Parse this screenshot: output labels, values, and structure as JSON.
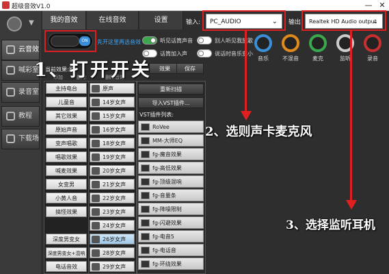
{
  "window": {
    "title": "超级音效V1.0",
    "min": "—",
    "close": "✕"
  },
  "tabs": [
    {
      "label": "我的音效"
    },
    {
      "label": "在线音效"
    },
    {
      "label": "设置"
    }
  ],
  "devices": {
    "input_label": "输入:",
    "input_value": "PC_AUDIO",
    "output_label": "输出:",
    "output_value": "Realtek HD Audio output"
  },
  "sidebar": [
    {
      "label": "云音效"
    },
    {
      "label": "喊彩室"
    },
    {
      "label": "录音室"
    },
    {
      "label": "教程"
    },
    {
      "label": "下载场"
    }
  ],
  "master_toggle": {
    "on_label": "ON",
    "caption": "先开这里再选音效"
  },
  "switches": [
    {
      "label": "听见话筒声音",
      "on": true
    },
    {
      "label": "别人听见我放歌",
      "on": false
    },
    {
      "label": "说话时音乐变小",
      "on": false
    },
    {
      "label": "话筒加入声",
      "on": false
    }
  ],
  "knobs": [
    {
      "label": "音乐",
      "color": "#3a8fd8"
    },
    {
      "label": "不混音",
      "color": "#e08a1e"
    },
    {
      "label": "麦克",
      "color": "#3aa84c"
    },
    {
      "label": "监听",
      "color": "#cccccc"
    },
    {
      "label": "录音",
      "color": "#c83030"
    }
  ],
  "effects_header": "当前效果:原",
  "mini_buttons": [
    "添加",
    "删除",
    "删除音效"
  ],
  "mid_top_buttons": [
    "效果",
    "保存"
  ],
  "mid_buttons": [
    "重新扫描",
    "导入VST插件..."
  ],
  "vst_header": "VST插件列表:",
  "presets": [
    "主持电台",
    "儿童音",
    "其它效果",
    "原始声音",
    "变声唱歌",
    "唱歌效果",
    "喊麦效果",
    "女变男",
    "小黄人音",
    "搞怪效果",
    "深度男变女",
    "深度男变女+混响",
    "电话音效"
  ],
  "samples": [
    "原声",
    "14岁女声",
    "15岁女声",
    "16岁女声",
    "18岁女声",
    "19岁女声",
    "20岁女声",
    "21岁女声",
    "22岁女声",
    "23岁女声",
    "24岁女声",
    "25岁女声",
    "26岁女声",
    "28岁女声",
    "29岁女声"
  ],
  "vst_plugins": [
    "RoVee",
    "MM-大师EQ",
    "fg-魔音效果",
    "fg-高低效果",
    "fg-顶级混响",
    "fg-音量条",
    "fg-降噪限制",
    "fg-闪避效果",
    "fg-电音5",
    "fg-电话音",
    "fg-环绕效果",
    "fg-..."
  ],
  "annotations": {
    "step1": "1、打开开关",
    "step2": "2、选则声卡麦克风",
    "step3": "3、选择监听耳机"
  }
}
